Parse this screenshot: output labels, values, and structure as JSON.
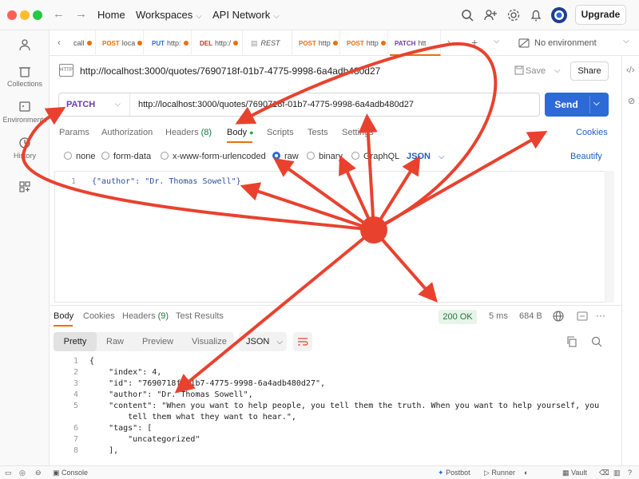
{
  "topbar": {
    "home": "Home",
    "workspaces": "Workspaces",
    "api_network": "API Network",
    "upgrade": "Upgrade"
  },
  "sidebar": {
    "items": [
      {
        "label": "Collections"
      },
      {
        "label": "Environments"
      },
      {
        "label": "History"
      }
    ]
  },
  "tabs": [
    {
      "method": "",
      "label": "call",
      "method_color": "#e8700c"
    },
    {
      "method": "POST",
      "label": "loca",
      "method_color": "#e8700c"
    },
    {
      "method": "PUT",
      "label": "http:",
      "method_color": "#2d6ad8"
    },
    {
      "method": "DEL",
      "label": "http:/",
      "method_color": "#c0392b"
    },
    {
      "method": "",
      "label": "REST",
      "method_color": "#777"
    },
    {
      "method": "POST",
      "label": "http",
      "method_color": "#e8700c"
    },
    {
      "method": "POST",
      "label": "http",
      "method_color": "#e8700c"
    },
    {
      "method": "PATCH",
      "label": "htt",
      "method_color": "#6a3ea5"
    }
  ],
  "environment": "No environment",
  "request": {
    "title": "http://localhost:3000/quotes/7690718f-01b7-4775-9998-6a4adb480d27",
    "save": "Save",
    "share": "Share",
    "method": "PATCH",
    "url": "http://localhost:3000/quotes/7690718f-01b7-4775-9998-6a4adb480d27",
    "send": "Send"
  },
  "request_tabs": {
    "params": "Params",
    "authorization": "Authorization",
    "headers": "Headers",
    "headers_count": "(8)",
    "body": "Body",
    "scripts": "Scripts",
    "tests": "Tests",
    "settings": "Settings",
    "cookies": "Cookies"
  },
  "body_types": {
    "none": "none",
    "form_data": "form-data",
    "urlencoded": "x-www-form-urlencoded",
    "raw": "raw",
    "binary": "binary",
    "graphql": "GraphQL",
    "format": "JSON",
    "beautify": "Beautify"
  },
  "editor": {
    "line": "1",
    "code": "{\"author\": \"Dr. Thomas Sowell\"}"
  },
  "response_tabs": {
    "body": "Body",
    "cookies": "Cookies",
    "headers": "Headers",
    "headers_count": "(9)",
    "test_results": "Test Results"
  },
  "response_meta": {
    "status": "200 OK",
    "time": "5 ms",
    "size": "684 B"
  },
  "view_tabs": {
    "pretty": "Pretty",
    "raw": "Raw",
    "preview": "Preview",
    "visualize": "Visualize",
    "format": "JSON"
  },
  "response_lines": [
    {
      "n": "1",
      "t": "{"
    },
    {
      "n": "2",
      "t": "    \"index\": 4,"
    },
    {
      "n": "3",
      "t": "    \"id\": \"7690718f-01b7-4775-9998-6a4adb480d27\","
    },
    {
      "n": "4",
      "t": "    \"author\": \"Dr. Thomas Sowell\","
    },
    {
      "n": "5",
      "t": "    \"content\": \"When you want to help people, you tell them the truth. When you want to help yourself, you"
    },
    {
      "n": "",
      "t": "        tell them what they want to hear.\","
    },
    {
      "n": "6",
      "t": "    \"tags\": ["
    },
    {
      "n": "7",
      "t": "        \"uncategorized\""
    },
    {
      "n": "8",
      "t": "    ],"
    }
  ],
  "footer": {
    "console": "Console",
    "postbot": "Postbot",
    "runner": "Runner",
    "vault": "Vault"
  },
  "colors": {
    "accent": "#e8700c",
    "send": "#2d6ad8",
    "annotation": "#e8422f",
    "status_ok": "#1a7a3e"
  }
}
